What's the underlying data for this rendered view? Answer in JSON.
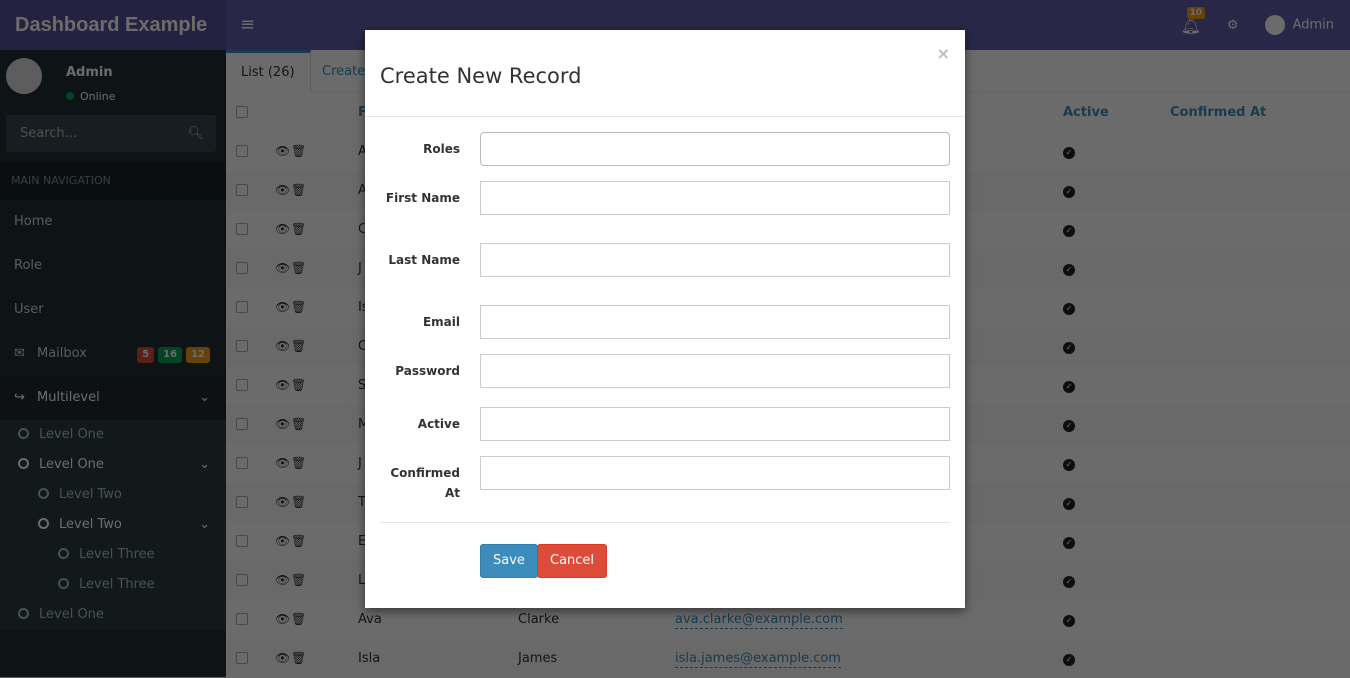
{
  "header": {
    "logo": "Dashboard Example",
    "notifications_count": "10",
    "user": "Admin"
  },
  "sidebar": {
    "user": "Admin",
    "status": "Online",
    "search_placeholder": "Search...",
    "section": "MAIN NAVIGATION",
    "items": [
      {
        "label": "Home"
      },
      {
        "label": "Role"
      },
      {
        "label": "User"
      },
      {
        "label": "Mailbox",
        "badges": [
          "5",
          "16",
          "12"
        ]
      },
      {
        "label": "Multilevel"
      }
    ],
    "sub": [
      "Level One",
      "Level One",
      "Level Two",
      "Level Two",
      "Level Three",
      "Level Three",
      "Level One"
    ],
    "badge_colors": [
      "#dd4b39",
      "#00a65a",
      "#f39c12"
    ]
  },
  "tabs": [
    "List (26)",
    "Create"
  ],
  "table": {
    "headers": [
      "F",
      "Active",
      "Confirmed At"
    ],
    "rows": [
      {
        "first": "A"
      },
      {
        "first": "A"
      },
      {
        "first": "C"
      },
      {
        "first": "J"
      },
      {
        "first": "Is"
      },
      {
        "first": "O"
      },
      {
        "first": "S"
      },
      {
        "first": "M"
      },
      {
        "first": "J"
      },
      {
        "first": "T"
      },
      {
        "first": "E"
      },
      {
        "first": "L"
      },
      {
        "first": "Ava",
        "last": "Clarke",
        "email": "ava.clarke@example.com"
      },
      {
        "first": "Isla",
        "last": "James",
        "email": "isla.james@example.com"
      }
    ]
  },
  "modal": {
    "title": "Create New Record",
    "close": "×",
    "fields": [
      "Roles",
      "First Name",
      "Last Name",
      "Email",
      "Password",
      "Active",
      "Confirmed At"
    ],
    "save": "Save",
    "cancel": "Cancel"
  }
}
